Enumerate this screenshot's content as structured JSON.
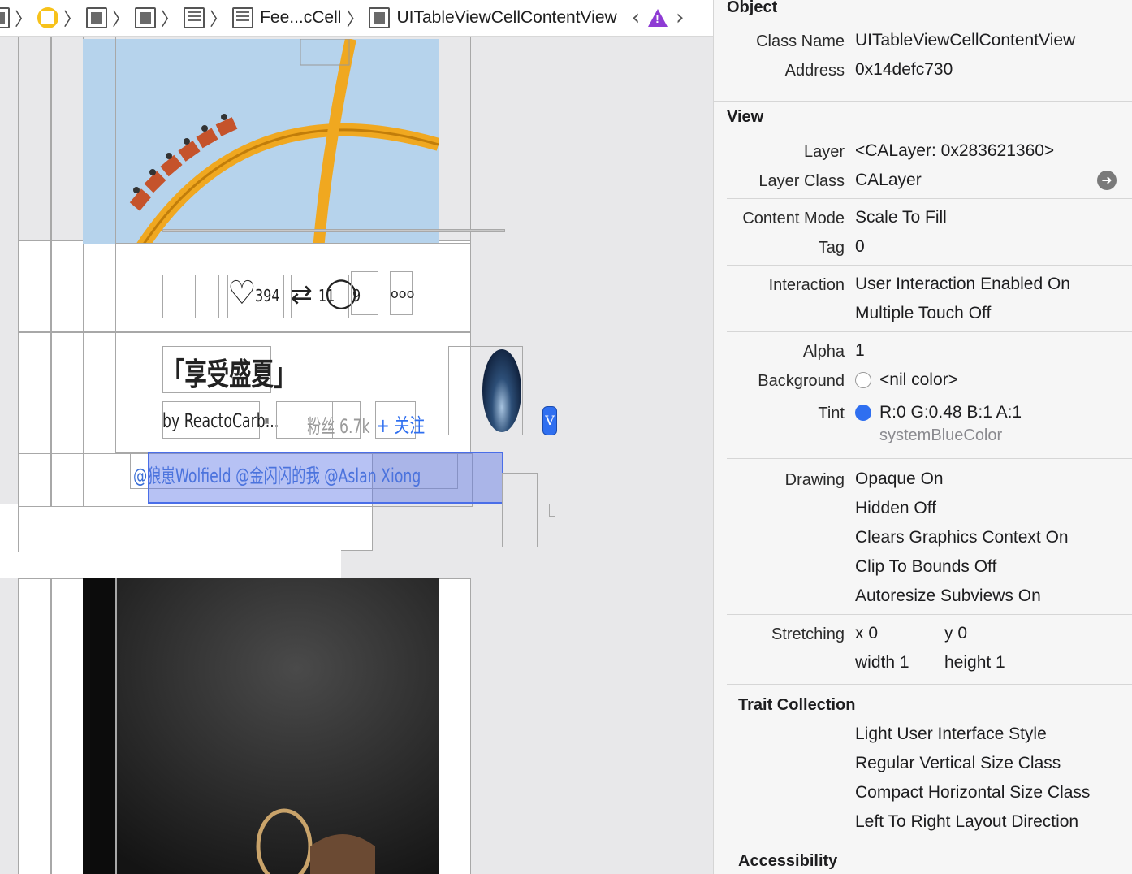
{
  "jumpbar": {
    "crumb_cell": "Fee...cCell",
    "crumb_selected": "UITableViewCellContentView"
  },
  "canvas": {
    "stats": {
      "likes": "394",
      "reposts": "11",
      "comments": "9",
      "more": "ooo"
    },
    "title": "「享受盛夏」",
    "author": "by ReactoCarb...",
    "fans": "粉丝 6.7k",
    "follow": "+ 关注",
    "mentions": "@狼崽Wolfield  @金闪闪的我  @Aslan Xiong",
    "badge": "V"
  },
  "inspector": {
    "object": {
      "title": "Object",
      "class_name_label": "Class Name",
      "class_name": "UITableViewCellContentView",
      "address_label": "Address",
      "address": "0x14defc730"
    },
    "view": {
      "title": "View",
      "layer_label": "Layer",
      "layer": "<CALayer: 0x283621360>",
      "layer_class_label": "Layer Class",
      "layer_class": "CALayer",
      "content_mode_label": "Content Mode",
      "content_mode": "Scale To Fill",
      "tag_label": "Tag",
      "tag": "0",
      "interaction_label": "Interaction",
      "interaction_1": "User Interaction Enabled On",
      "interaction_2": "Multiple Touch Off",
      "alpha_label": "Alpha",
      "alpha": "1",
      "background_label": "Background",
      "background": "<nil color>",
      "tint_label": "Tint",
      "tint": "R:0 G:0.48 B:1 A:1",
      "tint_name": "systemBlueColor",
      "tint_color": "#2f6ff0",
      "drawing_label": "Drawing",
      "drawing": [
        "Opaque On",
        "Hidden Off",
        "Clears Graphics Context On",
        "Clip To Bounds Off",
        "Autoresize Subviews On"
      ],
      "stretching_label": "Stretching",
      "stretch_x": "x  0",
      "stretch_y": "y  0",
      "stretch_w": "width  1",
      "stretch_h": "height  1"
    },
    "traits": {
      "title": "Trait Collection",
      "items": [
        "Light User Interface Style",
        "Regular Vertical Size Class",
        "Compact Horizontal Size Class",
        "Left To Right Layout Direction"
      ]
    },
    "accessibility": {
      "title": "Accessibility"
    }
  }
}
